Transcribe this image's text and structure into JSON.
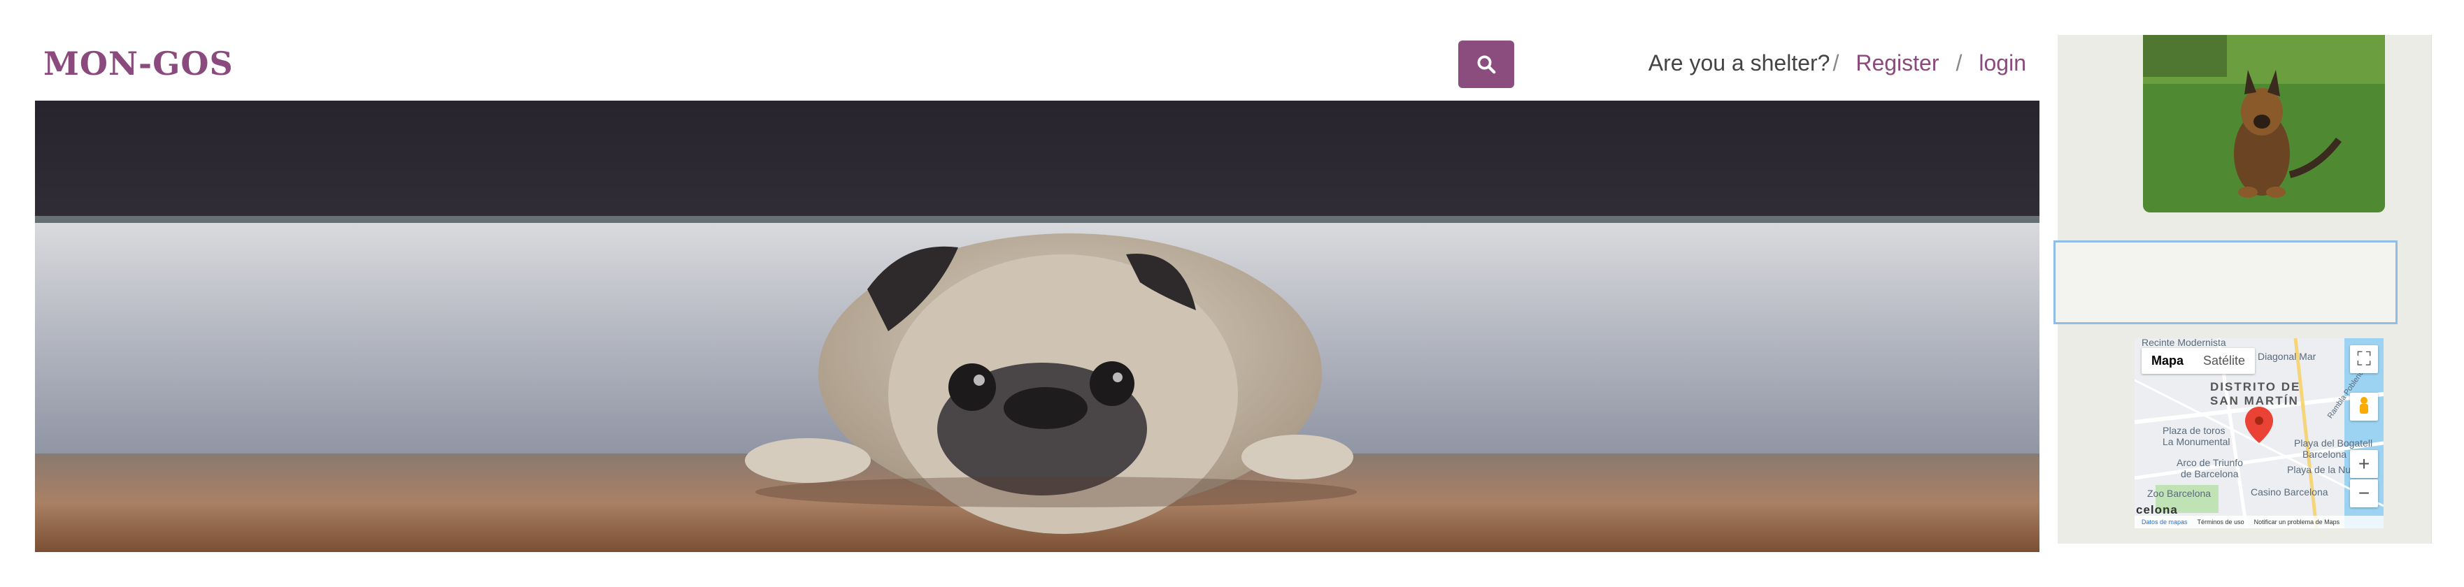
{
  "header": {
    "logo": "MON-GOS",
    "search_icon": "search-icon",
    "shelter_prompt": "Are you a shelter?",
    "sep1": "/",
    "register_label": "Register",
    "sep2": "/",
    "login_label": "login"
  },
  "colors": {
    "brand": "#8b4a7d",
    "sidebar_bg": "#ecece7",
    "focus_border": "#8fbde8"
  },
  "hero": {
    "image": "pug-lying-on-floor"
  },
  "sidebar": {
    "photo": "dog-on-grass",
    "map": {
      "tab_map": "Mapa",
      "tab_satellite": "Satélite",
      "labels": {
        "district_line1": "DISTRITO DE",
        "district_line2": "SAN MARTÍN",
        "plaza_toros_1": "Plaza de toros",
        "plaza_toros_2": "La Monumental",
        "arco_1": "Arco de Triunfo",
        "arco_2": "de Barcelona",
        "zoo": "Zoo Barcelona",
        "casino": "Casino Barcelona",
        "playa_bcn_1": "Playa del Bogatell",
        "playa_bcn_2": "Barcelona",
        "playa_nueva": "Playa de la Nueva",
        "rambla": "Rambla Poblenou",
        "recinte": "Recinte Modernista",
        "diagonal": "Diagonal Mar",
        "city": "celona"
      },
      "footer": {
        "data": "Datos de mapas",
        "terms": "Términos de uso",
        "report": "Notificar un problema de Maps"
      }
    }
  }
}
